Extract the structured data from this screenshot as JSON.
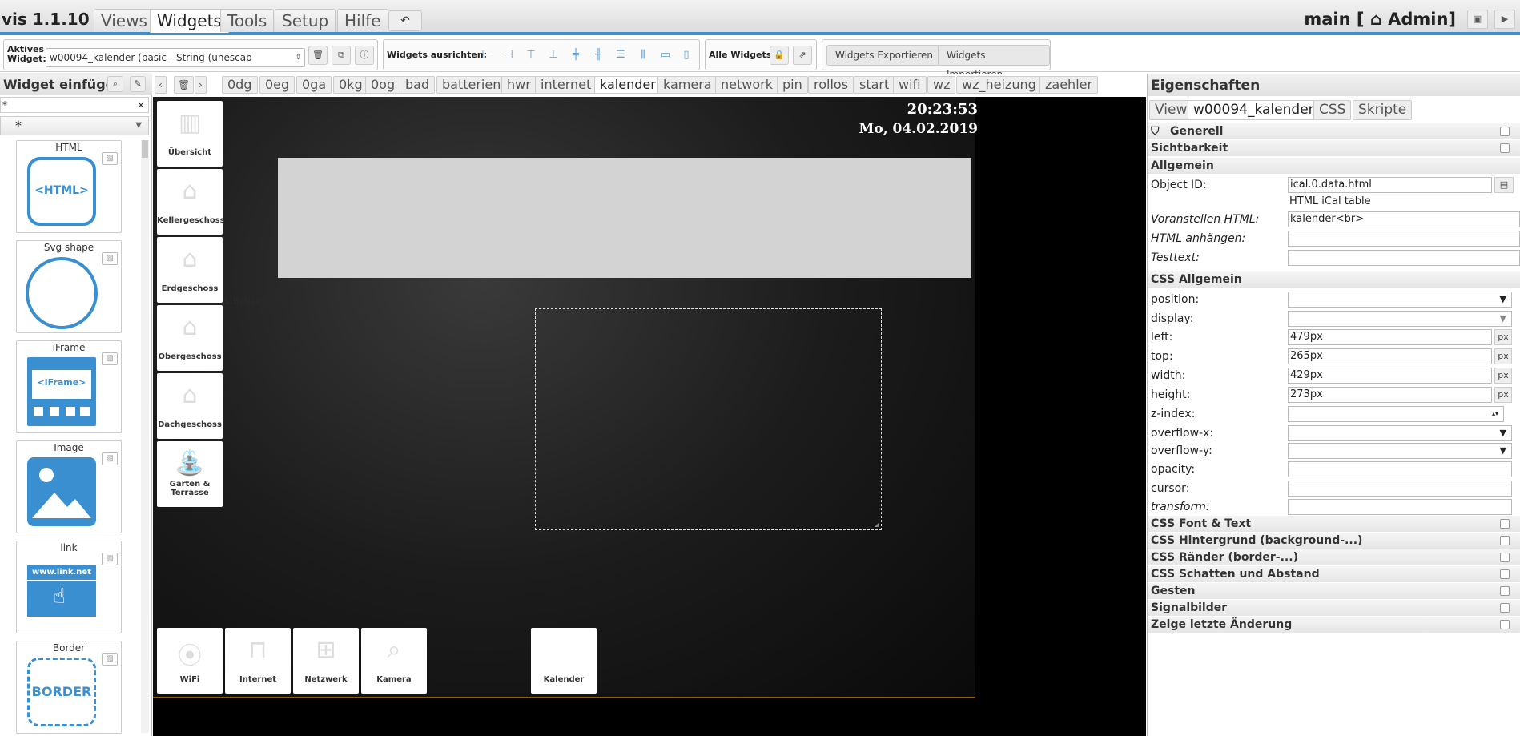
{
  "app": {
    "title": "vis 1.1.10",
    "project": "main [ ⌂ Admin]"
  },
  "menu": [
    "Views",
    "Widgets",
    "Tools",
    "Setup",
    "Hilfe"
  ],
  "menu_active": "Widgets",
  "toolbar": {
    "active_widget_label": "Aktives Widget:",
    "active_widget_value": "w00094_kalender (basic - String (unescap",
    "align_label": "Widgets ausrichten:",
    "all_widgets_label": "Alle Widgets:",
    "export_label": "Widgets Exportieren",
    "import_label": "Widgets Importieren"
  },
  "left_panel": {
    "title": "Widget einfügen",
    "filter_value": "*",
    "set_value": "*",
    "widgets": [
      {
        "name": "HTML",
        "preview": "<HTML>"
      },
      {
        "name": "Svg shape",
        "preview": ""
      },
      {
        "name": "iFrame",
        "preview": "<iFrame>"
      },
      {
        "name": "Image",
        "preview": ""
      },
      {
        "name": "link",
        "preview": "www.link.net"
      },
      {
        "name": "Border",
        "preview": "BORDER"
      }
    ]
  },
  "view_tabs": [
    "0dg",
    "0eg",
    "0ga",
    "0kg",
    "0og",
    "bad",
    "batterien",
    "hwr",
    "internet",
    "kalender",
    "kamera",
    "network",
    "pin",
    "rollos",
    "start",
    "wifi",
    "wz",
    "wz_heizung",
    "zaehler"
  ],
  "view_tab_active": "kalender",
  "canvas": {
    "clock": "20:23:53",
    "date": "Mo, 04.02.2019",
    "ghost_label": "alender",
    "nav_tiles": [
      "Übersicht",
      "Kellergeschoss",
      "Erdgeschoss",
      "Obergeschoss",
      "Dachgeschoss",
      "Garten & Terrasse"
    ],
    "bottom_tiles": [
      "WiFi",
      "Internet",
      "Netzwerk",
      "Kamera"
    ],
    "active_tile": "Kalender"
  },
  "right_panel": {
    "title": "Eigenschaften",
    "tabs": [
      "View",
      "w00094_kalender",
      "CSS",
      "Skripte"
    ],
    "tab_active": "w00094_kalender",
    "sections_top": [
      "Generell",
      "Sichtbarkeit"
    ],
    "allgemein_title": "Allgemein",
    "object_id_label": "Object ID:",
    "object_id_value": "ical.0.data.html",
    "object_id_desc": "HTML iCal table",
    "prepend_label": "Voranstellen HTML:",
    "prepend_value": "kalender<br>",
    "append_label": "HTML anhängen:",
    "testtext_label": "Testtext:",
    "css_title": "CSS Allgemein",
    "css_props": [
      {
        "label": "position:",
        "value": "",
        "type": "select"
      },
      {
        "label": "display:",
        "value": "",
        "type": "select"
      },
      {
        "label": "left:",
        "value": "479px",
        "type": "px"
      },
      {
        "label": "top:",
        "value": "265px",
        "type": "px"
      },
      {
        "label": "width:",
        "value": "429px",
        "type": "px"
      },
      {
        "label": "height:",
        "value": "273px",
        "type": "px"
      },
      {
        "label": "z-index:",
        "value": "",
        "type": "number"
      },
      {
        "label": "overflow-x:",
        "value": "",
        "type": "select"
      },
      {
        "label": "overflow-y:",
        "value": "",
        "type": "select"
      },
      {
        "label": "opacity:",
        "value": "",
        "type": "text"
      },
      {
        "label": "cursor:",
        "value": "",
        "type": "text"
      },
      {
        "label": "transform:",
        "value": "",
        "type": "text"
      }
    ],
    "sections_bottom": [
      "CSS Font & Text",
      "CSS Hintergrund (background-...)",
      "CSS Ränder (border-...)",
      "CSS Schatten und Abstand",
      "Gesten",
      "Signalbilder",
      "Zeige letzte Änderung"
    ]
  },
  "colors": {
    "accent": "#3c8ed2",
    "canvas_border": "#9a5a10",
    "widget_blue": "#3a8fd1"
  }
}
